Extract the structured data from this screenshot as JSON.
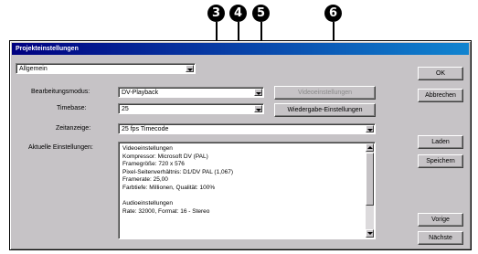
{
  "callouts": [
    "3",
    "4",
    "5",
    "6"
  ],
  "dialog": {
    "title": "Projekteinstellungen",
    "category": "Allgemein",
    "fields": {
      "editing_mode": {
        "label": "Bearbeitungsmodus:",
        "value": "DV-Playback"
      },
      "timebase": {
        "label": "Timebase:",
        "value": "25"
      },
      "timecode": {
        "label": "Zeitanzeige:",
        "value": "25 fps Timecode"
      }
    },
    "buttons": {
      "video_settings": "Videoeinstellungen",
      "playback_settings": "Wiedergabe-Einstellungen",
      "ok": "OK",
      "cancel": "Abbrechen",
      "load": "Laden",
      "save": "Speichern",
      "prev": "Vorige",
      "next": "Nächste"
    },
    "current_settings": {
      "label": "Aktuelle Einstellungen:",
      "lines": [
        "Videoeinstellungen",
        "Kompressor: Microsoft DV (PAL)",
        "Framegröße: 720 x 576",
        "Pixel-Seitenverhältnis: D1/DV PAL (1,067)",
        "Framerate: 25,00",
        "Farbtiefe: Millionen, Qualität: 100%",
        "",
        "Audioeinstellungen",
        "Rate: 32000, Format: 16 - Stereo"
      ]
    }
  }
}
